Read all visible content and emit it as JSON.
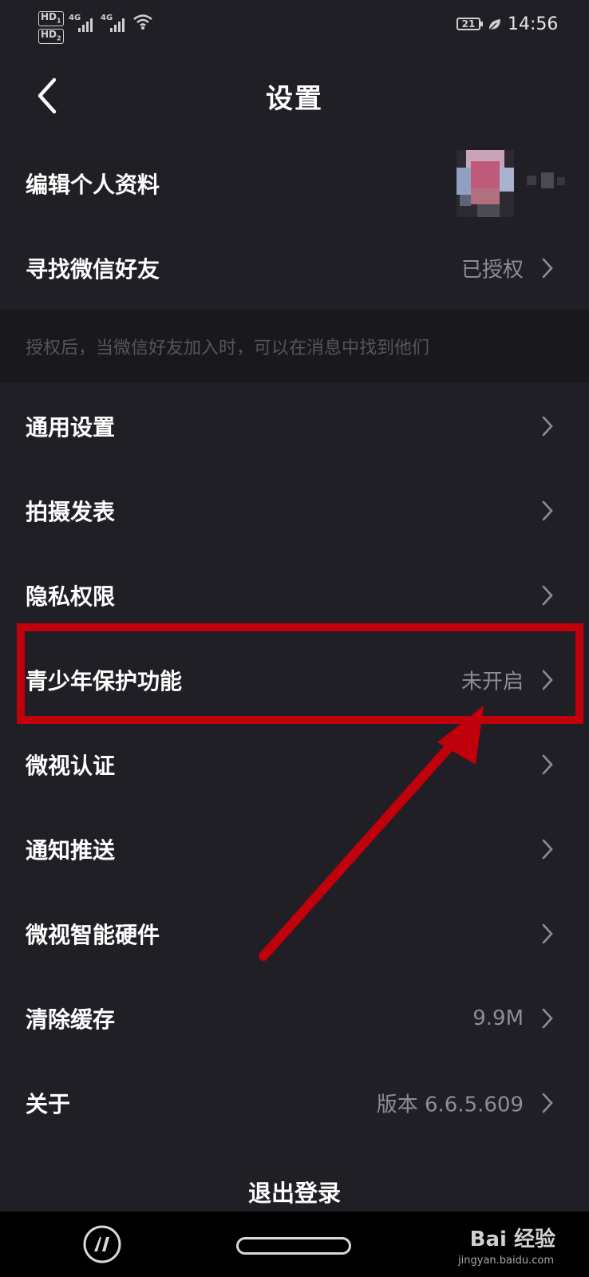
{
  "statusbar": {
    "hd1": "HD",
    "hd1_sub": "1",
    "hd2": "HD",
    "hd2_sub": "2",
    "signal1_label": "4G",
    "signal2_label": "4G",
    "battery": "21",
    "time": "14:56",
    "icons": [
      "signal-icon",
      "wifi-icon",
      "battery-icon",
      "power-saving-leaf-icon"
    ]
  },
  "header": {
    "title": "设置",
    "back_icon": "chevron-left-icon"
  },
  "profile": {
    "label": "编辑个人资料"
  },
  "wechat": {
    "label": "寻找微信好友",
    "value": "已授权",
    "hint": "授权后，当微信好友加入时，可以在消息中找到他们"
  },
  "settings": {
    "general": {
      "label": "通用设置"
    },
    "shooting": {
      "label": "拍摄发表"
    },
    "privacy": {
      "label": "隐私权限"
    },
    "teen": {
      "label": "青少年保护功能",
      "value": "未开启"
    },
    "verify": {
      "label": "微视认证"
    },
    "notify": {
      "label": "通知推送"
    },
    "hardware": {
      "label": "微视智能硬件"
    },
    "cache": {
      "label": "清除缓存",
      "value": "9.9M"
    },
    "about": {
      "label": "关于",
      "value": "版本 6.6.5.609"
    }
  },
  "logout": {
    "label": "退出登录"
  },
  "watermark": {
    "text": "Bai 经验",
    "sub": "jingyan.baidu.com"
  },
  "colors": {
    "background": "#1f1f25",
    "hint_band": "#18181d",
    "secondary_text": "#8d8d94",
    "annotation_red": "#c0000a"
  }
}
